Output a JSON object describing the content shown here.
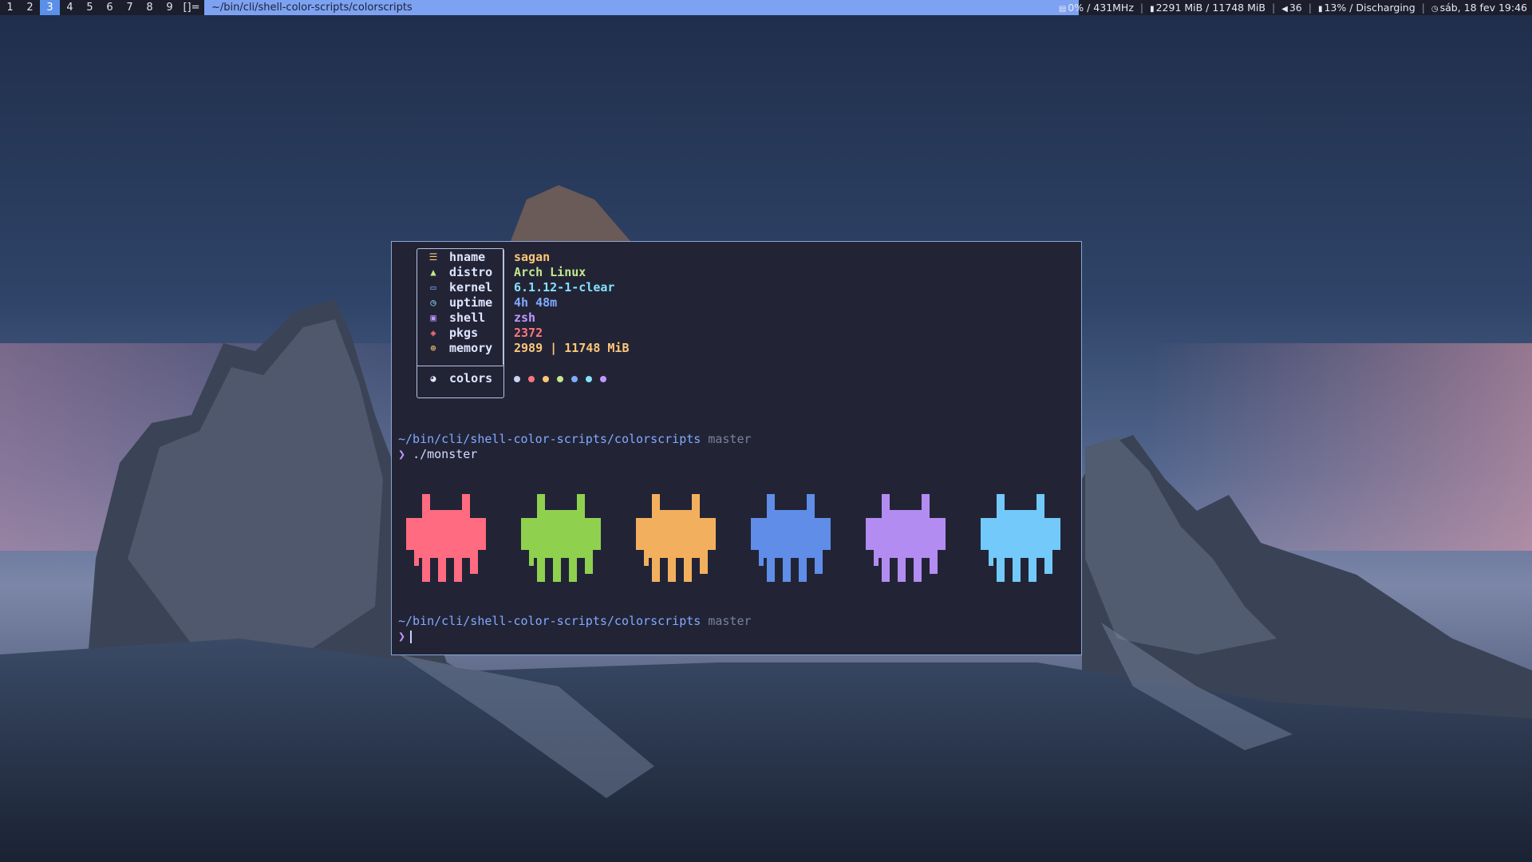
{
  "topbar": {
    "workspaces": [
      {
        "label": "1",
        "active": false
      },
      {
        "label": "2",
        "active": false
      },
      {
        "label": "3",
        "active": true
      },
      {
        "label": "4",
        "active": false
      },
      {
        "label": "5",
        "active": false
      },
      {
        "label": "6",
        "active": false
      },
      {
        "label": "7",
        "active": false
      },
      {
        "label": "8",
        "active": false
      },
      {
        "label": "9",
        "active": false
      }
    ],
    "layout_symbol": "[]=",
    "window_title": "~/bin/cli/shell-color-scripts/colorscripts",
    "status": {
      "cpu": "0% / 431MHz",
      "memory": "2291 MiB / 11748 MiB",
      "volume": "36",
      "battery": "13% / Discharging",
      "clock": "sáb, 18 fev 19:46"
    },
    "colors": {
      "bar_bg": "#1c1f2b",
      "title_bg": "#7ea2f2",
      "active_ws": "#5b8fe8"
    }
  },
  "terminal": {
    "fetch": {
      "rows": [
        {
          "icon": "sliders-icon",
          "key": "hname",
          "value": "sagan",
          "icon_color": "#ffc777",
          "value_color": "#ffc777"
        },
        {
          "icon": "arch-linux-icon",
          "key": "distro",
          "value": "Arch Linux",
          "icon_color": "#c3e88d",
          "value_color": "#c3e88d"
        },
        {
          "icon": "laptop-icon",
          "key": "kernel",
          "value": "6.1.12-1-clear",
          "icon_color": "#82aaff",
          "value_color": "#86e1fc"
        },
        {
          "icon": "clock-icon",
          "key": "uptime",
          "value": "4h 48m",
          "icon_color": "#86e1fc",
          "value_color": "#82aaff"
        },
        {
          "icon": "terminal-icon",
          "key": "shell",
          "value": "zsh",
          "icon_color": "#c099ff",
          "value_color": "#c099ff"
        },
        {
          "icon": "package-icon",
          "key": "pkgs",
          "value": "2372",
          "icon_color": "#ff757f",
          "value_color": "#ff757f"
        },
        {
          "icon": "memory-chip-icon",
          "key": "memory",
          "value": "2989 | 11748 MiB",
          "icon_color": "#ffc777",
          "value_color": "#ffc777"
        }
      ],
      "colors_label": "colors",
      "colors_icon": "palette-icon",
      "palette": [
        "#c8d3f5",
        "#ff757f",
        "#ffc777",
        "#c3e88d",
        "#82aaff",
        "#86e1fc",
        "#c099ff"
      ]
    },
    "session": {
      "path": "~/bin/cli/shell-color-scripts/colorscripts",
      "branch": "master",
      "prompt_symbol": "❯",
      "command": "./monster"
    },
    "monsters": [
      "#ff6b81",
      "#8fd14f",
      "#f2b05e",
      "#5f8de8",
      "#b38cf2",
      "#72c9fa"
    ]
  }
}
